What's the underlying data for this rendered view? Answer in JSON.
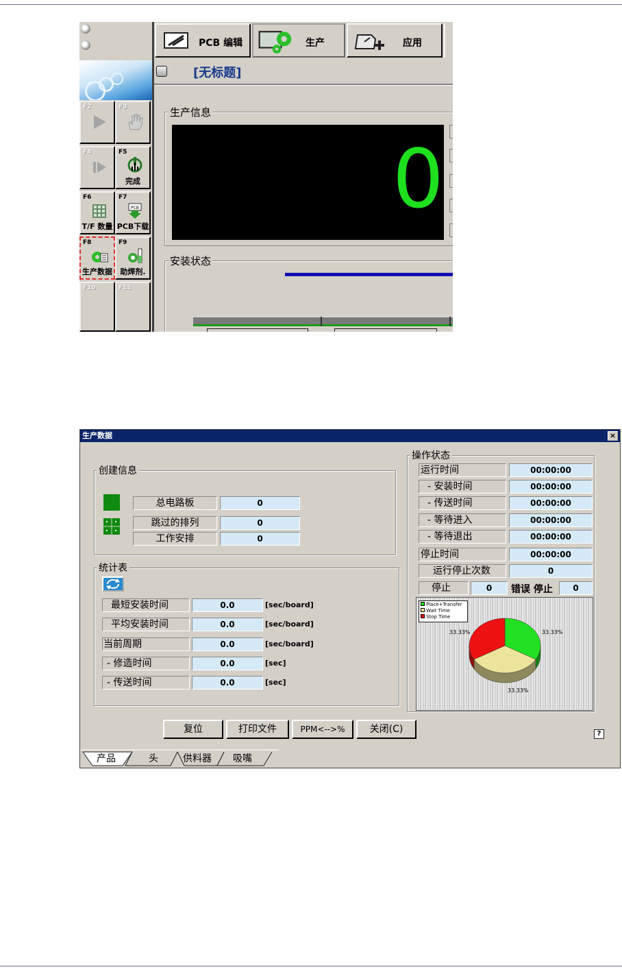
{
  "toolbar": {
    "tabs": [
      {
        "label": "PCB 编辑"
      },
      {
        "label": "生产"
      },
      {
        "label": "应用"
      }
    ],
    "doc_title": "[无标题]"
  },
  "fkeys": [
    {
      "key": "F2",
      "label": ""
    },
    {
      "key": "F3",
      "label": ""
    },
    {
      "key": "F4",
      "label": ""
    },
    {
      "key": "F5",
      "label": "完成"
    },
    {
      "key": "F6",
      "label": "T/F 数量"
    },
    {
      "key": "F7",
      "label": "PCB下载"
    },
    {
      "key": "F8",
      "label": "生产数据"
    },
    {
      "key": "F9",
      "label": "助焊剂."
    },
    {
      "key": "F10",
      "label": ""
    },
    {
      "key": "F11",
      "label": ""
    }
  ],
  "production_info": {
    "title": "生产信息",
    "counter": "0"
  },
  "mount_status": {
    "title": "安装状态"
  },
  "icons": {
    "pcb_edit": "pcb-edit-icon",
    "production": "production-gear-icon",
    "apply": "apply-icon",
    "play": "play-icon",
    "hand": "hand-icon",
    "step": "step-icon",
    "finish": "finish-icon",
    "grid": "grid-icon",
    "download": "pcb-download-icon",
    "prod_data": "production-data-icon",
    "flux": "flux-icon",
    "refresh": "refresh-icon",
    "help": "help-icon"
  },
  "dialog": {
    "title": "生产数据",
    "close_label": "×",
    "creation": {
      "title": "创建信息",
      "rows": [
        {
          "label": "总电路板",
          "value": "0"
        },
        {
          "label": "跳过的排列",
          "value": "0"
        },
        {
          "label": "工作安排",
          "value": "0"
        }
      ]
    },
    "stats": {
      "title": "统计表",
      "rows": [
        {
          "label": "最短安装时间",
          "value": "0.0",
          "unit": "[sec/board]"
        },
        {
          "label": "平均安装时间",
          "value": "0.0",
          "unit": "[sec/board]"
        },
        {
          "label": "当前周期",
          "value": "0.0",
          "unit": "[sec/board]"
        },
        {
          "label": "- 修造时间",
          "value": "0.0",
          "unit": "[sec]"
        },
        {
          "label": "- 传送时间",
          "value": "0.0",
          "unit": "[sec]"
        }
      ]
    },
    "op_status": {
      "title": "操作状态",
      "rows": [
        {
          "label": "运行时间",
          "value": "00:00:00"
        },
        {
          "label": "- 安装时间",
          "value": "00:00:00"
        },
        {
          "label": "- 传送时间",
          "value": "00:00:00"
        },
        {
          "label": "- 等待进入",
          "value": "00:00:00"
        },
        {
          "label": "- 等待退出",
          "value": "00:00:00"
        },
        {
          "label": "停止时间",
          "value": "00:00:00"
        },
        {
          "label": "运行停止次数",
          "value": "0"
        }
      ],
      "stop_label": "停止",
      "stop_value": "0",
      "error_stop_label": "错误 停止",
      "error_stop_value": "0"
    },
    "pie": {
      "legend": [
        "Place+Transfer",
        "Wait Time",
        "Stop Time"
      ],
      "slices": [
        {
          "name": "Place+Transfer",
          "value": 33.33,
          "label": "33.33%",
          "color": "#22e022"
        },
        {
          "name": "Wait Time",
          "value": 33.33,
          "label": "33.33%",
          "color": "#ece49a"
        },
        {
          "name": "Stop Time",
          "value": 33.33,
          "label": "33.33%",
          "color": "#ee1111"
        }
      ]
    },
    "buttons": {
      "reset": "复位",
      "print": "打印文件",
      "ppm": "PPM<-->%",
      "close": "关闭(C)"
    },
    "help_label": "?",
    "tabs": [
      "产品",
      "头",
      "供料器",
      "吸嘴"
    ]
  }
}
